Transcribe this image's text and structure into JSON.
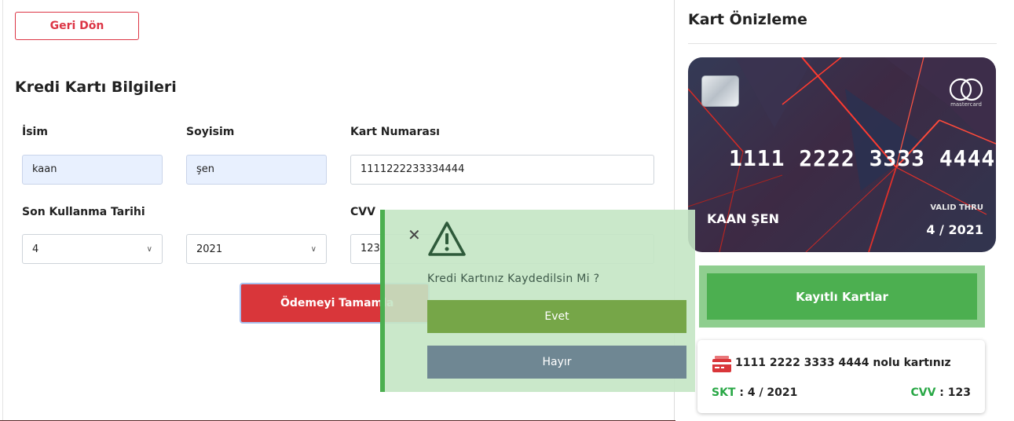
{
  "header": {
    "back_label": "Geri Dön"
  },
  "form": {
    "title": "Kredi Kartı Bilgileri",
    "name_label": "İsim",
    "name_value": "kaan",
    "surname_label": "Soyisim",
    "surname_value": "şen",
    "card_number_label": "Kart Numarası",
    "card_number_value": "1111222233334444",
    "expiry_label": "Son Kullanma Tarihi",
    "expiry_month": "4",
    "expiry_year": "2021",
    "cvv_label": "CVV",
    "cvv_value": "123",
    "submit_label": "Ödemeyi Tamamla"
  },
  "preview": {
    "title": "Kart Önizleme",
    "card_number": "1111 2222 3333 4444",
    "holder": "KAAN ŞEN",
    "valid_thru_label": "VALID THRU",
    "valid_thru_value": "4 / 2021",
    "brand": "mastercard"
  },
  "saved": {
    "button_label": "Kayıtlı Kartlar",
    "item_text": "1111 2222 3333 4444 nolu kartınız",
    "skt_label": "SKT",
    "skt_value": ": 4 / 2021",
    "cvv_label": "CVV",
    "cvv_value": ": 123"
  },
  "modal": {
    "message": "Kredi Kartınız Kaydedilsin Mi ?",
    "yes_label": "Evet",
    "no_label": "Hayır"
  },
  "icons": {
    "close": "close-icon",
    "warning": "warning-icon",
    "credit_card": "credit-card-icon",
    "chevron": "chevron-down-icon"
  },
  "colors": {
    "danger": "#dc3545",
    "success": "#4caf50",
    "yes": "#76a648",
    "no": "#6f8793"
  }
}
